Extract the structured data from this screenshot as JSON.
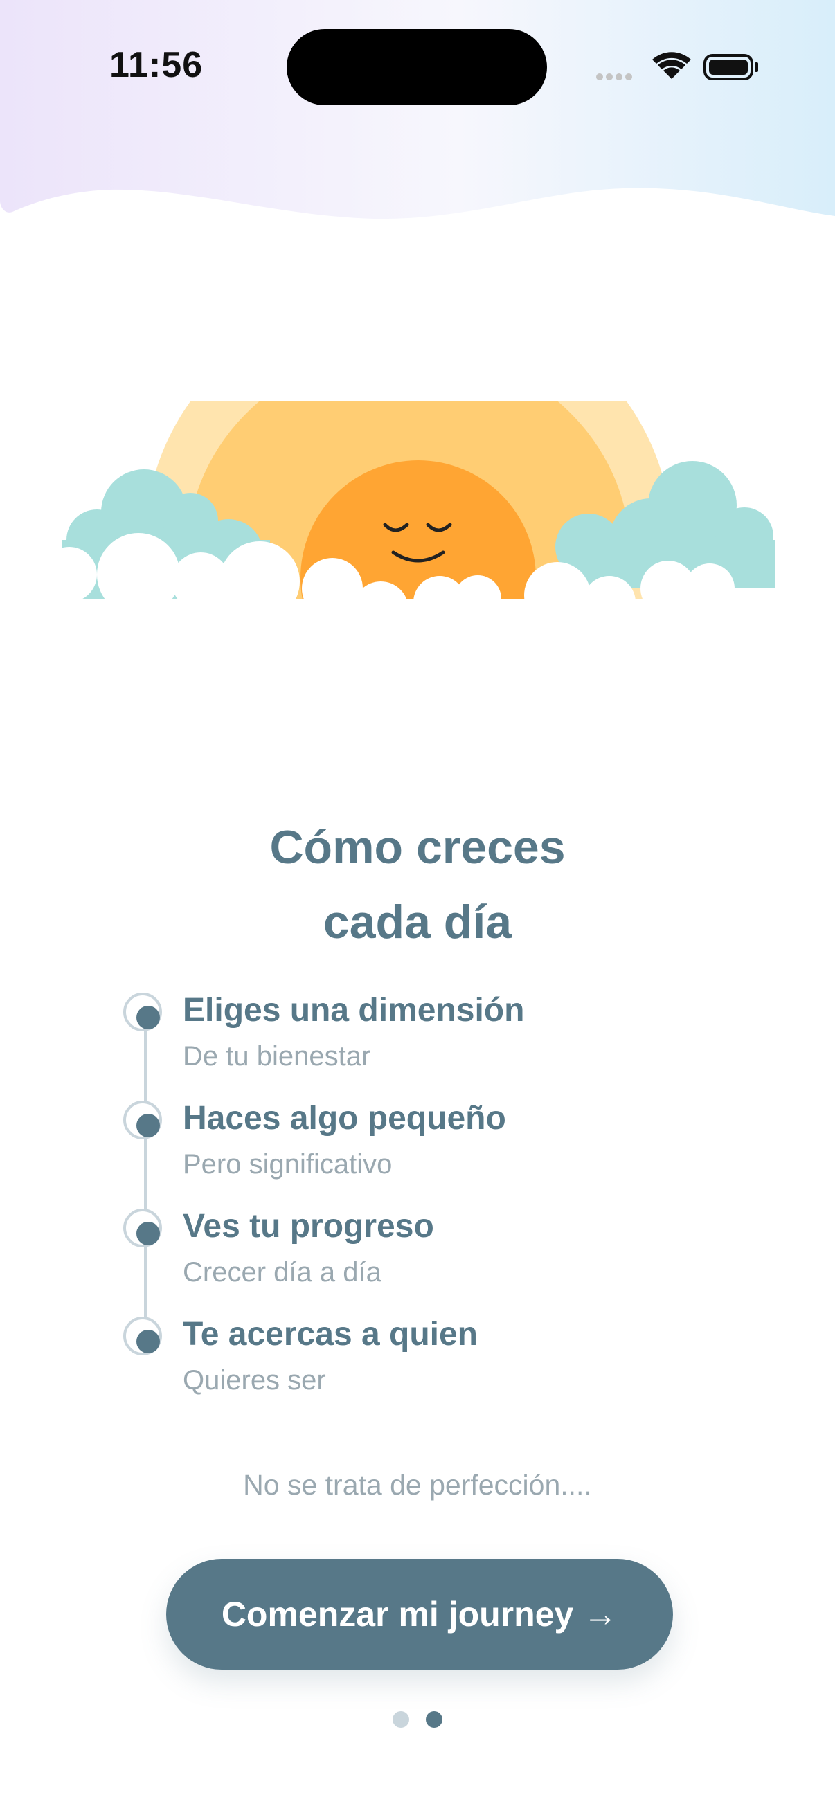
{
  "status_bar": {
    "time": "11:56",
    "icons": [
      "signal-icon",
      "wifi-icon",
      "battery-icon"
    ]
  },
  "hero": {
    "illustration": "sun-rising-over-clouds",
    "colors": {
      "outer_arc": "#FFE4AE",
      "middle_arc": "#FFCD73",
      "sun": "#FFA533",
      "cloud_back": "#A8DFDC",
      "cloud_front": "#FFFFFF"
    }
  },
  "title": {
    "line1": "Cómo creces",
    "line2": "cada día"
  },
  "steps": [
    {
      "title": "Eliges una dimensión",
      "subtitle": "De tu bienestar"
    },
    {
      "title": "Haces algo pequeño",
      "subtitle": "Pero significativo"
    },
    {
      "title": "Ves tu progreso",
      "subtitle": "Crecer día a día"
    },
    {
      "title": "Te acercas a quien",
      "subtitle": "Quieres ser"
    }
  ],
  "note": "No se trata de perfección....",
  "cta": {
    "label": "Comenzar mi journey →"
  },
  "pager": {
    "total": 2,
    "current": 2
  },
  "colors": {
    "primary": "#577888",
    "muted_text": "#9AA8B0",
    "timeline": "#C9D5DC",
    "gradient_left": "#ECE4FA",
    "gradient_right": "#D8EEFA"
  }
}
